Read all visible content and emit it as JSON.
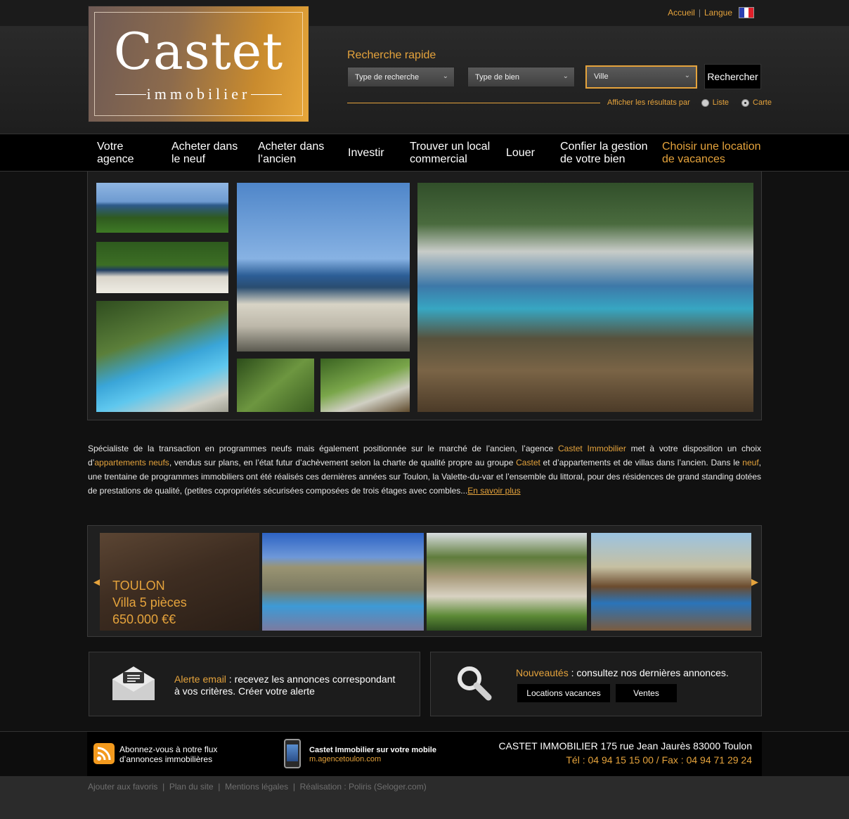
{
  "brand": {
    "name": "Castet",
    "sub": "immobilier"
  },
  "toplinks": {
    "home": "Accueil",
    "sep": "|",
    "language": "Langue"
  },
  "search": {
    "title": "Recherche rapide",
    "type_recherche": "Type de recherche",
    "type_bien": "Type de bien",
    "ville": "Ville",
    "button": "Rechercher",
    "display_label": "Afficher les résultats par",
    "opt_list": "Liste",
    "opt_map": "Carte",
    "selected": "Carte"
  },
  "nav": [
    {
      "label": "Votre agence"
    },
    {
      "label": "Acheter dans le neuf"
    },
    {
      "label": "Acheter dans l’ancien"
    },
    {
      "label": "Investir"
    },
    {
      "label": "Trouver un local commercial"
    },
    {
      "label": "Louer"
    },
    {
      "label": "Confier la gestion de votre bien"
    },
    {
      "label": "Choisir une location de vacances"
    }
  ],
  "intro": {
    "p1": "Spécialiste de la transaction en programmes neufs mais également positionnée sur le marché de l’ancien, l’agence ",
    "l1": "Castet Immobilier",
    "p2": " met à votre disposition un choix d’",
    "l2": "appartements neufs",
    "p3": ", vendus sur plans, en l’état futur d’achèvement selon la charte de qualité propre au groupe ",
    "l3": "Castet",
    "p4": " et d’appartements et de villas dans l’ancien. Dans le ",
    "l4": "neuf",
    "p5": ", une trentaine de programmes immobiliers ont été réalisés ces dernières années sur Toulon, la Valette-du-var et l’ensemble du littoral, pour des résidences de grand standing dotées de prestations de qualité, (petites copropriétés sécurisées composées de trois étages avec combles...",
    "more": "En savoir plus"
  },
  "carousel": {
    "city": "TOULON",
    "title": "Villa 5 pièces",
    "price": "650.000 €€"
  },
  "alert": {
    "label": "Alerte email",
    "text": " : recevez les annonces correspondant à vos critères. Créer votre alerte"
  },
  "news": {
    "label": "Nouveautés",
    "text": " : consultez nos dernières annonces.",
    "btn1": "Locations vacances",
    "btn2": "Ventes"
  },
  "footer": {
    "rss": "Abonnez-vous à notre flux d’annonces immobilières",
    "mobile_title": "Castet Immobilier sur votre mobile",
    "mobile_url": "m.agencetoulon.com",
    "address": "CASTET IMMOBILIER 175 rue Jean Jaurès 83000 Toulon",
    "phone": "Tél : 04 94 15 15 00 / Fax : 04 94 71 29 24"
  },
  "bottom": [
    "Ajouter aux favoris",
    "Plan du site",
    "Mentions légales",
    "Réalisation : Poliris (Seloger.com)"
  ],
  "colors": {
    "accent": "#e5a33c",
    "background": "#111111",
    "nav": "#000000"
  }
}
